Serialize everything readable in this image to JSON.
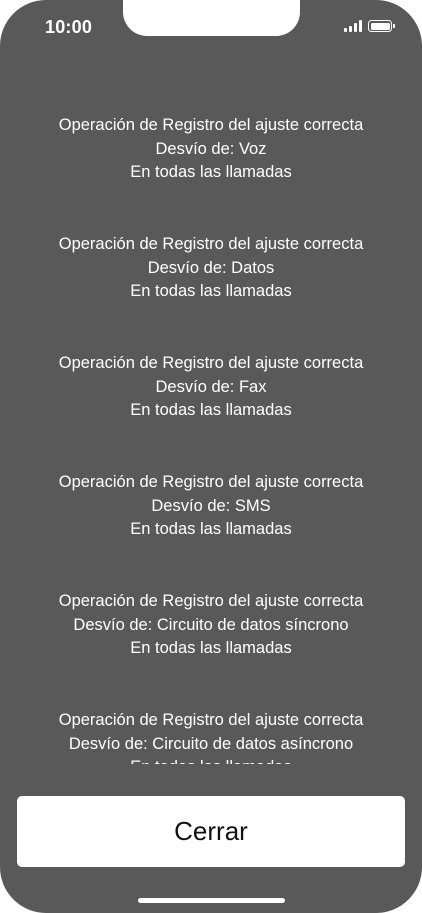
{
  "status_bar": {
    "time": "10:00",
    "signal_icon": "signal-bars-icon",
    "battery_icon": "battery-icon"
  },
  "messages": [
    {
      "line1": "Operación de Registro del ajuste correcta",
      "line2": "Desvío de: Voz",
      "line3": "En todas las llamadas"
    },
    {
      "line1": "Operación de Registro del ajuste correcta",
      "line2": "Desvío de: Datos",
      "line3": "En todas las llamadas"
    },
    {
      "line1": "Operación de Registro del ajuste correcta",
      "line2": "Desvío de: Fax",
      "line3": "En todas las llamadas"
    },
    {
      "line1": "Operación de Registro del ajuste correcta",
      "line2": "Desvío de: SMS",
      "line3": "En todas las llamadas"
    },
    {
      "line1": "Operación de Registro del ajuste correcta",
      "line2": "Desvío de: Circuito de datos síncrono",
      "line3": "En todas las llamadas"
    },
    {
      "line1": "Operación de Registro del ajuste correcta",
      "line2": "Desvío de: Circuito de datos asíncrono",
      "line3": "En todas las llamadas"
    }
  ],
  "actions": {
    "close_label": "Cerrar"
  },
  "colors": {
    "background": "#595959",
    "text": "#ffffff",
    "button_bg": "#ffffff",
    "button_text": "#111111"
  }
}
